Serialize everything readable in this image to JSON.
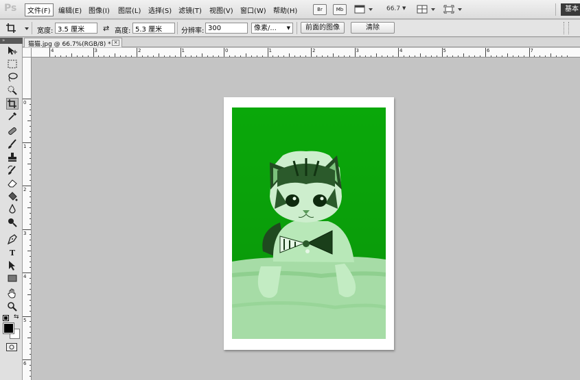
{
  "app": {
    "logo": "Ps"
  },
  "menu": {
    "items": [
      "文件(F)",
      "编辑(E)",
      "图像(I)",
      "图层(L)",
      "选择(S)",
      "滤镜(T)",
      "视图(V)",
      "窗口(W)",
      "帮助(H)"
    ],
    "bridge_label": "Br",
    "minibridge_label": "Mb",
    "zoom_level": "66.7",
    "workspace_label": "基本"
  },
  "options": {
    "width_label": "宽度:",
    "width_value": "3.5 厘米",
    "height_label": "高度:",
    "height_value": "5.3 厘米",
    "resolution_label": "分辨率:",
    "resolution_value": "300",
    "unit_value": "像素/...",
    "front_image_label": "前面的图像",
    "clear_label": "清除"
  },
  "document": {
    "tab_title": "猫猫.jpg @ 66.7%(RGB/8) *",
    "close_glyph": "×"
  },
  "rulers": {
    "horizontal_labels": [
      "4",
      "3",
      "2",
      "1",
      "0",
      "1",
      "2",
      "3",
      "4",
      "5",
      "6",
      "7"
    ],
    "vertical_labels": [
      "0",
      "1",
      "2",
      "3",
      "4",
      "5",
      "6"
    ]
  },
  "toolbox": {
    "tools": [
      "move-tool",
      "marquee-tool",
      "lasso-tool",
      "quick-select-tool",
      "crop-tool",
      "eyedropper-tool",
      "healing-brush-tool",
      "brush-tool",
      "clone-stamp-tool",
      "history-brush-tool",
      "eraser-tool",
      "paint-bucket-tool",
      "blur-tool",
      "dodge-tool",
      "pen-tool",
      "type-tool",
      "path-select-tool",
      "shape-tool",
      "hand-tool",
      "zoom-tool"
    ],
    "type_glyph": "T",
    "foreground_color": "#000000",
    "background_color": "#ffffff"
  },
  "image": {
    "tint_color": "#0ea00e",
    "subject": "cat-with-bow-tie"
  }
}
